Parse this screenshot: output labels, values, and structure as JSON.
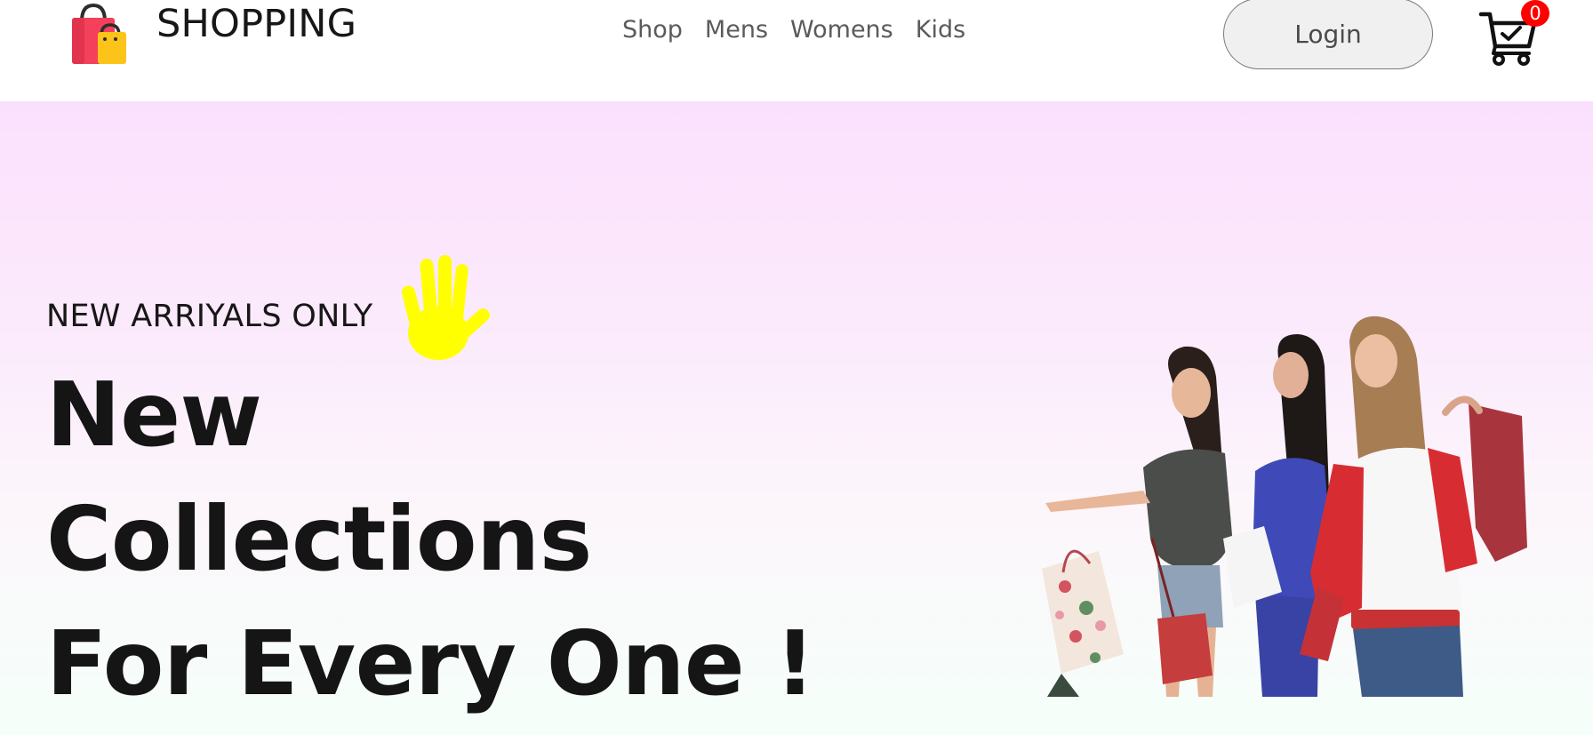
{
  "header": {
    "brand_title": "SHOPPING",
    "brand_icon": "shopping-bags-icon",
    "menu": [
      {
        "label": "Shop"
      },
      {
        "label": "Mens"
      },
      {
        "label": "Womens"
      },
      {
        "label": "Kids"
      }
    ],
    "login_label": "Login",
    "cart_icon": "cart-icon",
    "cart_count": "0"
  },
  "hero": {
    "tagline": "NEW ARRIYALS ONLY",
    "tagline_icon": "hand-wave-icon",
    "headline_lines": [
      "New",
      "Collections",
      "For Every One !"
    ],
    "image": "shopping-women-photo"
  },
  "colors": {
    "hero_gradient_top": "#fbe0fd",
    "hero_gradient_bottom": "#f5fffa",
    "badge": "#ff0000",
    "hand": "#ffff00",
    "bag_red": "#f4405a",
    "bag_yellow": "#fcc419"
  }
}
